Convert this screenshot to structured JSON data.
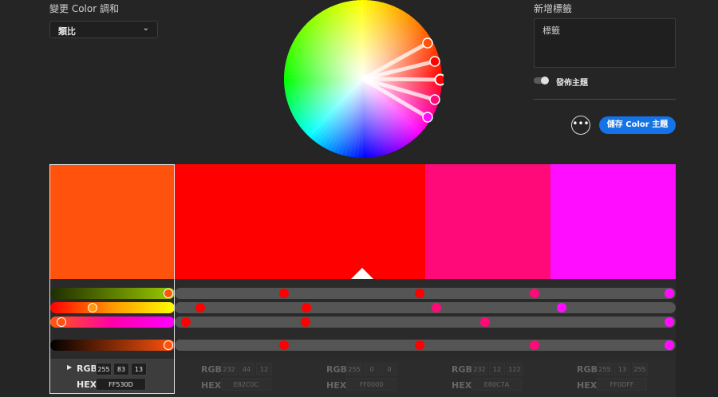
{
  "harmony": {
    "label": "變更 Color 調和",
    "selected": "類比"
  },
  "tags": {
    "label": "新增標籤",
    "placeholder": "標籤"
  },
  "publish": {
    "label": "發佈主題"
  },
  "actions": {
    "more": "•••",
    "save": "儲存 Color 主題"
  },
  "palette": [
    {
      "hex": "FF530D",
      "rgb": [
        "255",
        "83",
        "13"
      ],
      "color": "#FF530D",
      "selected": true
    },
    {
      "hex": "E82C0C",
      "rgb": [
        "232",
        "44",
        "12"
      ],
      "color": "#FF0000",
      "selected": false
    },
    {
      "hex": "FF0000",
      "rgb": [
        "255",
        "0",
        "0"
      ],
      "color": "#FF0000",
      "selected": false
    },
    {
      "hex": "E80C7A",
      "rgb": [
        "232",
        "12",
        "122"
      ],
      "color": "#FF0A78",
      "selected": false
    },
    {
      "hex": "FF0DFF",
      "rgb": [
        "255",
        "13",
        "255"
      ],
      "color": "#FF0DFF",
      "selected": false
    }
  ],
  "value_labels": {
    "rgb": "RGB",
    "hex": "HEX"
  }
}
